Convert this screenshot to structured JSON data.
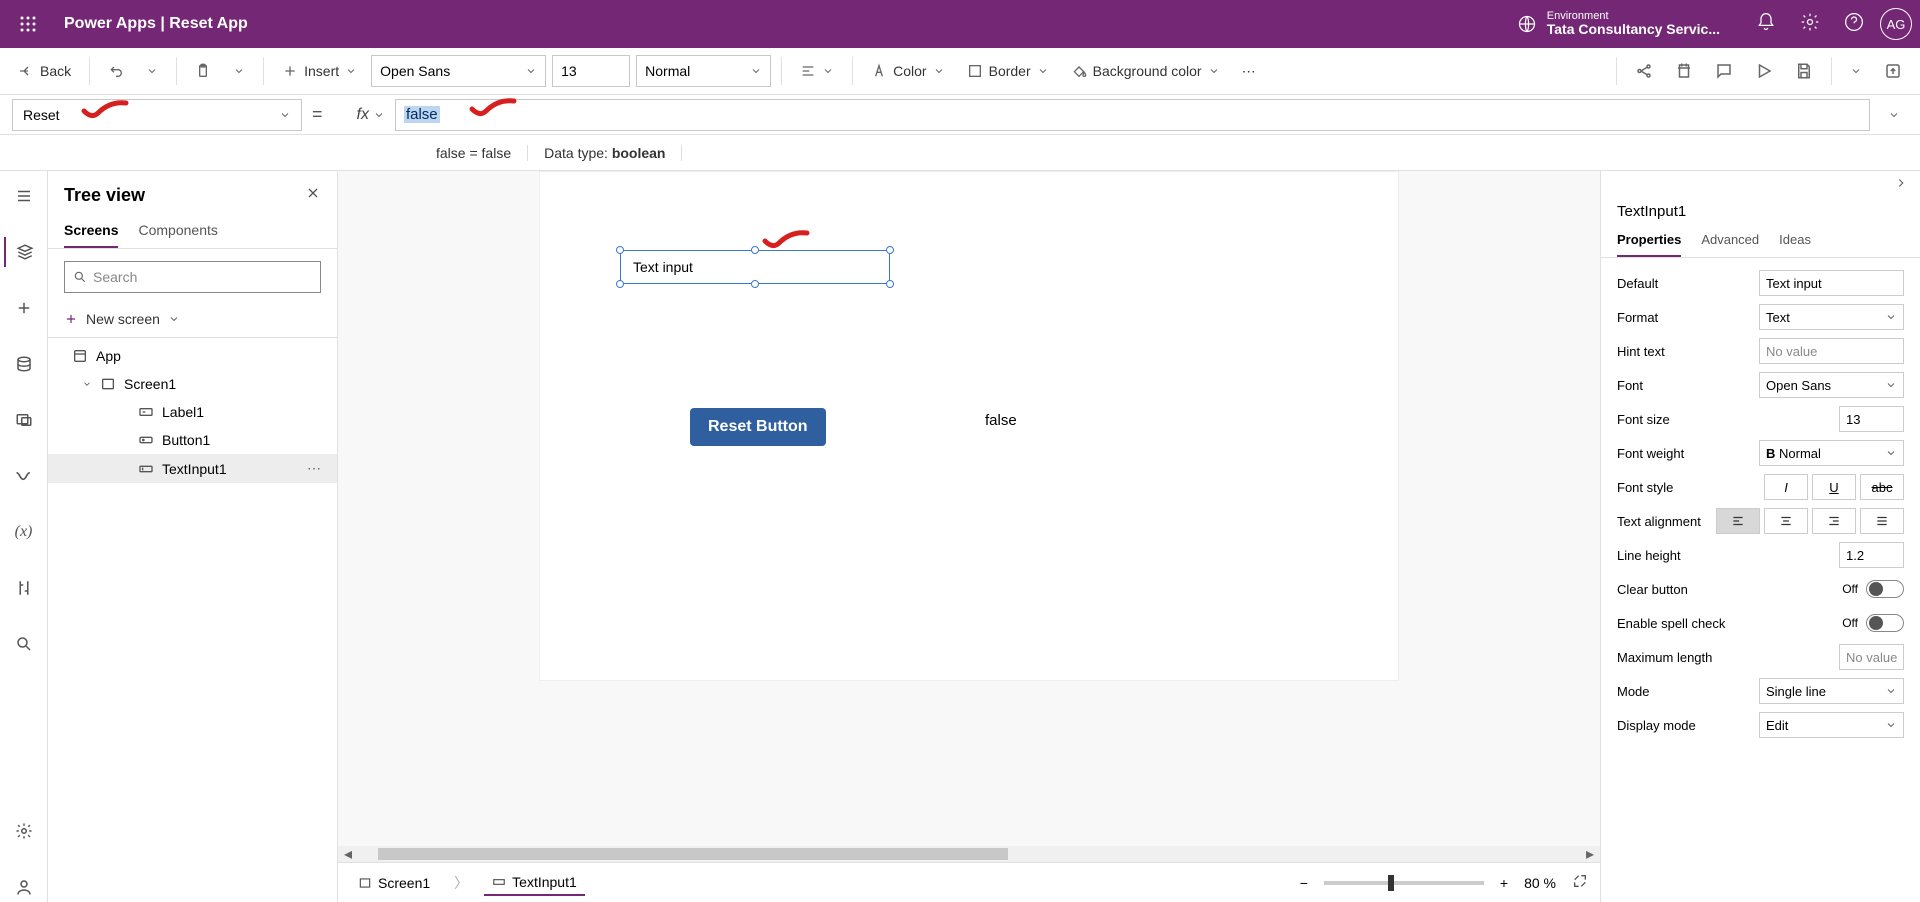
{
  "header": {
    "app_title": "Power Apps  |  Reset App",
    "env_label": "Environment",
    "env_name": "Tata Consultancy Servic...",
    "avatar": "AG"
  },
  "ribbon": {
    "back": "Back",
    "insert": "Insert",
    "font": "Open Sans",
    "font_size": "13",
    "font_weight": "Normal",
    "color": "Color",
    "border": "Border",
    "background": "Background color"
  },
  "formula": {
    "property": "Reset",
    "fx_label": "fx",
    "value": "false",
    "result": "false  =  false",
    "datatype_label": "Data type: ",
    "datatype": "boolean"
  },
  "treeview": {
    "title": "Tree view",
    "tab_screens": "Screens",
    "tab_components": "Components",
    "search_placeholder": "Search",
    "new_screen": "New screen",
    "items": {
      "app": "App",
      "screen1": "Screen1",
      "label1": "Label1",
      "button1": "Button1",
      "textinput1": "TextInput1"
    }
  },
  "canvas": {
    "textinput_text": "Text input",
    "reset_button": "Reset Button",
    "label_text": "false",
    "crumb_screen": "Screen1",
    "crumb_control": "TextInput1",
    "zoom": "80  %"
  },
  "props": {
    "title": "TextInput1",
    "tabs": {
      "properties": "Properties",
      "advanced": "Advanced",
      "ideas": "Ideas"
    },
    "rows": {
      "default": {
        "l": "Default",
        "v": "Text input"
      },
      "format": {
        "l": "Format",
        "v": "Text"
      },
      "hint": {
        "l": "Hint text",
        "v": "No value"
      },
      "font": {
        "l": "Font",
        "v": "Open Sans"
      },
      "fontsize": {
        "l": "Font size",
        "v": "13"
      },
      "fontweight": {
        "l": "Font weight",
        "v": "Normal"
      },
      "fontstyle": {
        "l": "Font style"
      },
      "align": {
        "l": "Text alignment"
      },
      "lineheight": {
        "l": "Line height",
        "v": "1.2"
      },
      "clear": {
        "l": "Clear button",
        "v": "Off"
      },
      "spell": {
        "l": "Enable spell check",
        "v": "Off"
      },
      "maxlen": {
        "l": "Maximum length",
        "v": "No value"
      },
      "mode": {
        "l": "Mode",
        "v": "Single line"
      },
      "display": {
        "l": "Display mode",
        "v": "Edit"
      }
    }
  }
}
